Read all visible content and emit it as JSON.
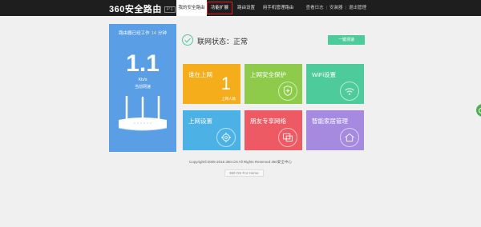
{
  "header": {
    "logo": "360安全路由",
    "model_badge": "P1",
    "tabs": [
      {
        "label": "我的安全路由",
        "state": "active"
      },
      {
        "label": "功能扩展",
        "state": "highlighted"
      },
      {
        "label": "路由设置",
        "state": "normal"
      },
      {
        "label": "用手机管理路由",
        "state": "normal"
      }
    ],
    "links": [
      "查看日志",
      "安装器",
      "退出管理"
    ]
  },
  "status_panel": {
    "uptime_prefix": "路由器已经工作",
    "uptime_value": "14",
    "uptime_unit": "分钟",
    "speed_value": "1.1",
    "speed_unit": "Kb/s",
    "speed_label": "当前网速",
    "device_icon": "router-icon"
  },
  "connection": {
    "status_text": "联网状态：正常",
    "status_icon": "check-circle-icon",
    "speed_test_button": "一键测速"
  },
  "tiles": [
    {
      "label": "谁在上网",
      "color": "#f5ad1c",
      "icon": "count",
      "count": "1",
      "count_label": "上网人数"
    },
    {
      "label": "上网安全保护",
      "color": "#8ecb4a",
      "icon": "shield-plus-icon"
    },
    {
      "label": "WiFi设置",
      "color": "#4ecb9a",
      "icon": "wifi-icon"
    },
    {
      "label": "上网设置",
      "color": "#4cb2e6",
      "icon": "gear-icon"
    },
    {
      "label": "朋友专享网络",
      "color": "#ee5a64",
      "icon": "screens-icon"
    },
    {
      "label": "智能家居管理",
      "color": "#a58ae0",
      "icon": "home-icon"
    }
  ],
  "footer": {
    "copyright": "Copyright©2005-2016 360.CN All Rights Reserved 360安全中心",
    "link": "360 OS For Home"
  },
  "side_float_icon": "chat-bubble-icon"
}
